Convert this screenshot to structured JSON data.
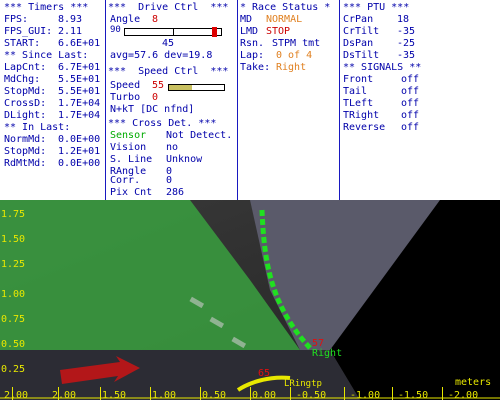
{
  "timers": {
    "header": "*** Timers ***",
    "fps_label": "FPS:",
    "fps_value": "8.93",
    "fpsgui_label": "FPS_GUI:",
    "fpsgui_value": "2.11",
    "start_label": "START:",
    "start_value": "6.6E+01",
    "since_last_header": "** Since Last:",
    "lapcnt_label": "LapCnt:",
    "lapcnt_value": "6.7E+01",
    "mdchg_label": "MdChg:",
    "mdchg_value": "5.5E+01",
    "stopmd_label": "StopMd:",
    "stopmd_value": "5.5E+01",
    "crossd_label": "CrossD:",
    "crossd_value": "1.7E+04",
    "dlight_label": "DLight:",
    "dlight_value": "1.7E+04",
    "in_last_header": "** In Last:",
    "normmd_label": "NormMd:",
    "normmd_value": "0.0E+00",
    "stopmd2_label": "StopMd:",
    "stopmd2_value": "1.2E+01",
    "rdmtmd_label": "RdMtMd:",
    "rdmtmd_value": "0.0E+00"
  },
  "drive_ctrl": {
    "header": "***  Drive Ctrl  ***",
    "angle_label": "Angle",
    "angle_value": "8",
    "angle_min": "90",
    "angle_scale_mid": "45",
    "angle_fraction": 0.93,
    "avg_line": "avg=57.6 dev=19.8"
  },
  "speed_ctrl": {
    "header": "***  Speed Ctrl  ***",
    "speed_label": "Speed",
    "speed_value": "55",
    "speed_fraction": 0.42,
    "turbo_label": "Turbo",
    "turbo_value": "0",
    "nkt_line": "N+kT [DC nfnd]"
  },
  "cross_det": {
    "header": "*** Cross Det. ***",
    "sensor_label": "Sensor",
    "sensor_value": "Not Detect.",
    "vision_label": "Vision",
    "vision_value": "no",
    "sline_label": "S. Line",
    "sline_value": "Unknow",
    "rangle_label": "RAngle",
    "rangle_value": "0",
    "corr_label": "Corr.",
    "corr_value": "0",
    "pixcnt_label": "Pix Cnt",
    "pixcnt_value": "286"
  },
  "race_status": {
    "header": "* Race Status *",
    "md_label": "MD",
    "md_value": "NORMAL",
    "lmd_label": "LMD",
    "lmd_value": "STOP",
    "rsn_label": "Rsn.",
    "rsn_value": "STPM tmt",
    "lap_label": "Lap:",
    "lap_value": "0 of 4",
    "take_label": "Take:",
    "take_value": "Right"
  },
  "ptu": {
    "header": "*** PTU ***",
    "crpan_label": "CrPan",
    "crpan_value": "18",
    "crtilt_label": "CrTilt",
    "crtilt_value": "-35",
    "dspan_label": "DsPan",
    "dspan_value": "-25",
    "dstilt_label": "DsTilt",
    "dstilt_value": "-35"
  },
  "signals": {
    "header": "** SIGNALS **",
    "front_label": "Front",
    "front_value": "off",
    "tail_label": "Tail",
    "tail_value": "off",
    "tleft_label": "TLeft",
    "tleft_value": "off",
    "tright_label": "TRight",
    "tright_value": "off",
    "reverse_label": "Reverse",
    "reverse_value": "off"
  },
  "camera": {
    "y_ticks": [
      "1.75",
      "1.50",
      "1.25",
      "1.00",
      "0.75",
      "0.50",
      "0.25"
    ],
    "x_ticks": [
      "2.00",
      "2.00",
      "1.50",
      "1.00",
      "0.50",
      "0.00",
      "-0.50",
      "-1.00",
      "-1.50",
      "-2.00"
    ],
    "units": "meters",
    "path_label": "Right",
    "path_marker": "57",
    "target_marker": "65",
    "target_label": "LRingtp",
    "colors": {
      "green_overlay": "#3aa040",
      "path": "#20e020",
      "red": "#e01010",
      "yellow": "#e8e800"
    }
  }
}
